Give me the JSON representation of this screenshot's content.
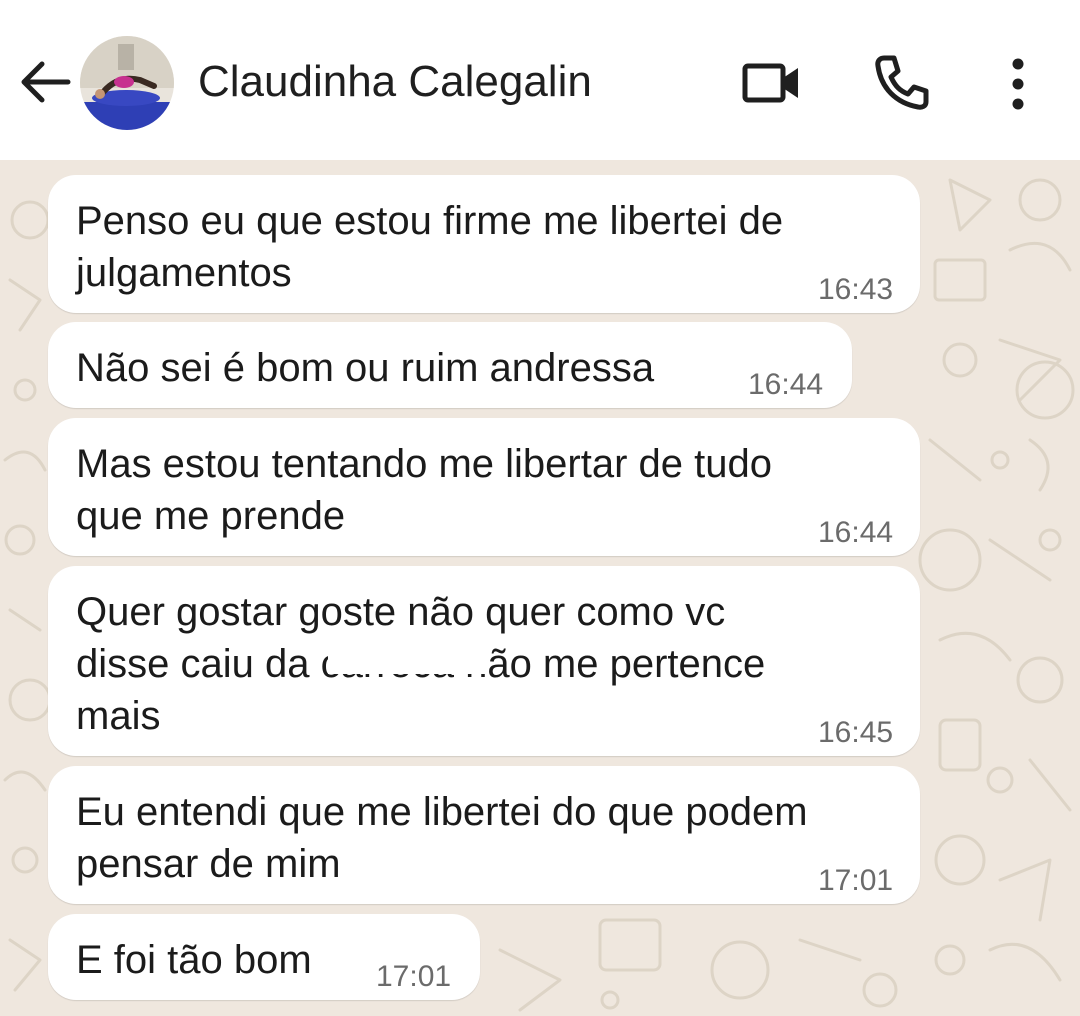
{
  "header": {
    "contact_name": "Claudinha Calegalin",
    "icons": [
      "back-arrow-icon",
      "video-call-icon",
      "phone-call-icon",
      "more-options-icon"
    ]
  },
  "messages": [
    {
      "line1": "Penso eu que estou firme me libertei de",
      "line2": "julgamentos",
      "time": "16:43"
    },
    {
      "line1": "Não sei é bom ou ruim andressa",
      "time": "16:44"
    },
    {
      "line1": "Mas estou tentando me libertar de tudo",
      "line2": "que me prende",
      "time": "16:44"
    },
    {
      "line1": "Quer gostar goste não quer como vc",
      "line2": "disse caiu da carroca não me pertence",
      "line3": "mais",
      "time": "16:45"
    },
    {
      "line1": "Eu entendi que me libertei do que podem",
      "line2": "pensar de mim",
      "time": "17:01"
    },
    {
      "line1": "E foi tão bom",
      "time": "17:01"
    }
  ],
  "colors": {
    "wallpaper": "#efe7de",
    "bubble": "#ffffff",
    "time_text": "#6b6b6b",
    "header_bg": "#ffffff"
  }
}
